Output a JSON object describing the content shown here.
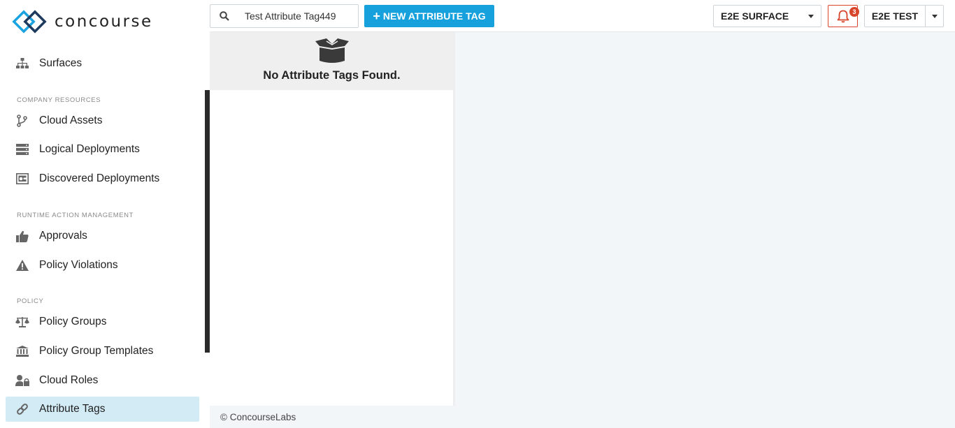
{
  "brand": {
    "name": "concourse"
  },
  "sidebar": {
    "top_item": {
      "label": "Surfaces",
      "icon": "sitemap-icon"
    },
    "sections": [
      {
        "title": "COMPANY RESOURCES",
        "items": [
          {
            "label": "Cloud Assets",
            "icon": "branch-icon"
          },
          {
            "label": "Logical Deployments",
            "icon": "server-icon"
          },
          {
            "label": "Discovered Deployments",
            "icon": "discovered-icon"
          }
        ]
      },
      {
        "title": "RUNTIME ACTION MANAGEMENT",
        "items": [
          {
            "label": "Approvals",
            "icon": "thumbs-up-icon"
          },
          {
            "label": "Policy Violations",
            "icon": "warning-icon"
          }
        ]
      },
      {
        "title": "POLICY",
        "items": [
          {
            "label": "Policy Groups",
            "icon": "scale-icon"
          },
          {
            "label": "Policy Group Templates",
            "icon": "bank-icon"
          },
          {
            "label": "Cloud Roles",
            "icon": "user-lock-icon"
          },
          {
            "label": "Attribute Tags",
            "icon": "link-icon",
            "active": true
          }
        ]
      }
    ]
  },
  "topbar": {
    "search_value": "Test Attribute Tag449",
    "new_button_label": "NEW ATTRIBUTE TAG",
    "surface_select": "E2E SURFACE",
    "notification_count": "3",
    "user_label": "E2E TEST"
  },
  "content": {
    "empty_message": "No Attribute Tags Found."
  },
  "footer": {
    "text": "© ConcourseLabs"
  },
  "colors": {
    "accent": "#16a1dd",
    "active_bg": "#d2ebf5",
    "alert": "#d9452b"
  }
}
